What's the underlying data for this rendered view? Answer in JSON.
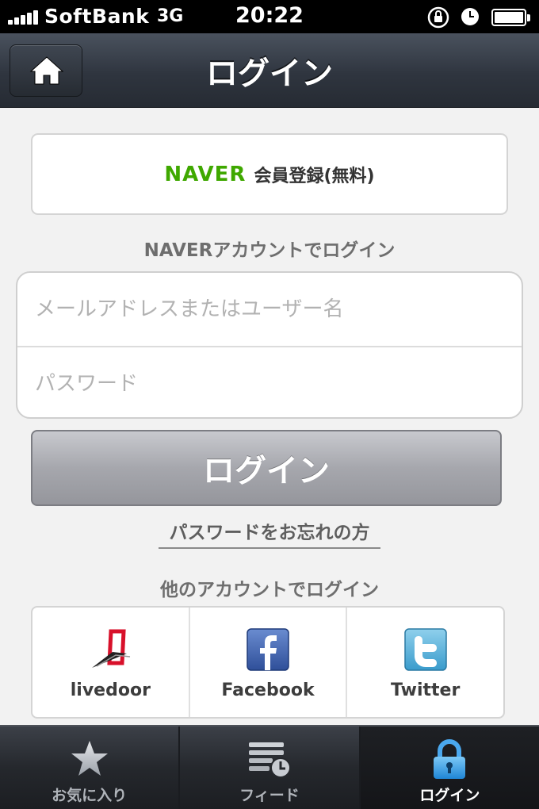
{
  "status_bar": {
    "carrier": "SoftBank",
    "network": "3G",
    "time": "20:22",
    "battery_level": 1.0
  },
  "nav": {
    "title": "ログイン",
    "home_icon": "home-icon"
  },
  "register": {
    "logo": "NAVER",
    "label": "会員登録(無料)"
  },
  "naver_login_label": "NAVERアカウントでログイン",
  "form": {
    "email_placeholder": "メールアドレスまたはユーザー名",
    "password_placeholder": "パスワード"
  },
  "login_button": "ログイン",
  "forgot_password": "パスワードをお忘れの方",
  "other_login_label": "他のアカウントでログイン",
  "social": [
    {
      "name": "livedoor",
      "icon": "livedoor-icon"
    },
    {
      "name": "Facebook",
      "icon": "facebook-icon"
    },
    {
      "name": "Twitter",
      "icon": "twitter-icon"
    }
  ],
  "tabs": [
    {
      "label": "お気に入り",
      "icon": "star-icon",
      "active": false
    },
    {
      "label": "フィード",
      "icon": "feed-icon",
      "active": false
    },
    {
      "label": "ログイン",
      "icon": "lock-icon",
      "active": true
    }
  ],
  "colors": {
    "naver_green": "#3fa800",
    "active_tab_icon": "#3aa0ea"
  }
}
